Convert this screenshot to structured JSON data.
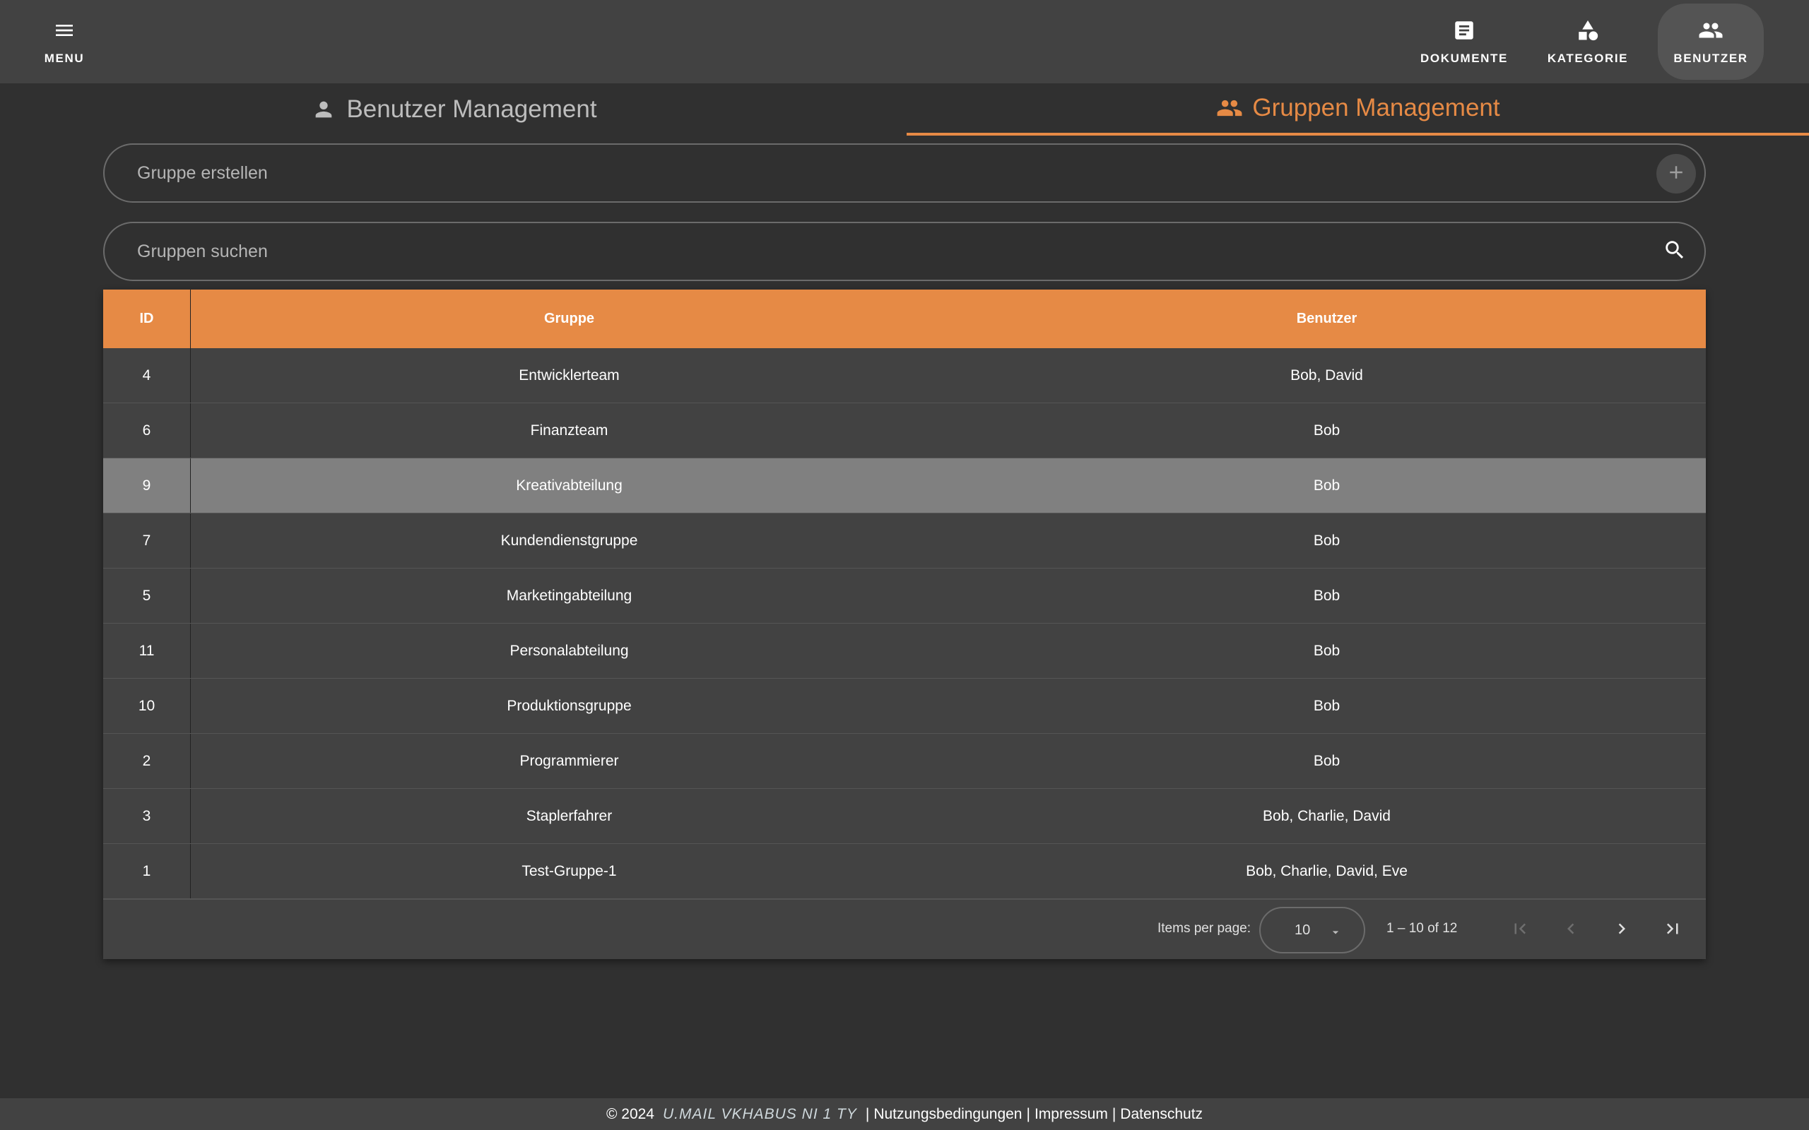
{
  "topbar": {
    "menu_label": "MENU",
    "nav": [
      {
        "label": "DOKUMENTE",
        "icon": "document-icon"
      },
      {
        "label": "KATEGORIE",
        "icon": "category-shapes-icon"
      },
      {
        "label": "BENUTZER",
        "icon": "people-icon",
        "active": true
      }
    ]
  },
  "tabs": [
    {
      "label": "Benutzer Management",
      "icon": "person-icon",
      "active": false
    },
    {
      "label": "Gruppen Management",
      "icon": "group-icon",
      "active": true
    }
  ],
  "create_group": {
    "placeholder": "Gruppe erstellen",
    "value": "",
    "button_icon": "plus-icon"
  },
  "search_groups": {
    "placeholder": "Gruppen suchen",
    "value": "",
    "button_icon": "search-icon"
  },
  "table": {
    "headers": {
      "id": "ID",
      "group": "Gruppe",
      "users": "Benutzer"
    },
    "rows": [
      {
        "id": "4",
        "group": "Entwicklerteam",
        "users": "Bob, David"
      },
      {
        "id": "6",
        "group": "Finanzteam",
        "users": "Bob"
      },
      {
        "id": "9",
        "group": "Kreativabteilung",
        "users": "Bob"
      },
      {
        "id": "7",
        "group": "Kundendienstgruppe",
        "users": "Bob"
      },
      {
        "id": "5",
        "group": "Marketingabteilung",
        "users": "Bob"
      },
      {
        "id": "11",
        "group": "Personalabteilung",
        "users": "Bob"
      },
      {
        "id": "10",
        "group": "Produktionsgruppe",
        "users": "Bob"
      },
      {
        "id": "2",
        "group": "Programmierer",
        "users": "Bob"
      },
      {
        "id": "3",
        "group": "Staplerfahrer",
        "users": "Bob, Charlie, David"
      },
      {
        "id": "1",
        "group": "Test-Gruppe-1",
        "users": "Bob, Charlie, David, Eve"
      }
    ],
    "highlighted_row_id": "9"
  },
  "paginator": {
    "items_per_page_label": "Items per page:",
    "items_per_page_value": "10",
    "range_label": "1 – 10 of 12"
  },
  "footer": {
    "copyright": "© 2024",
    "company": "U.MAIL VKHABUS NI 1 TY",
    "links": [
      "Nutzungsbedingungen",
      "Impressum",
      "Datenschutz"
    ]
  },
  "colors": {
    "accent": "#e68a45",
    "background": "#303030",
    "surface": "#424242",
    "highlight_row": "#808080"
  }
}
